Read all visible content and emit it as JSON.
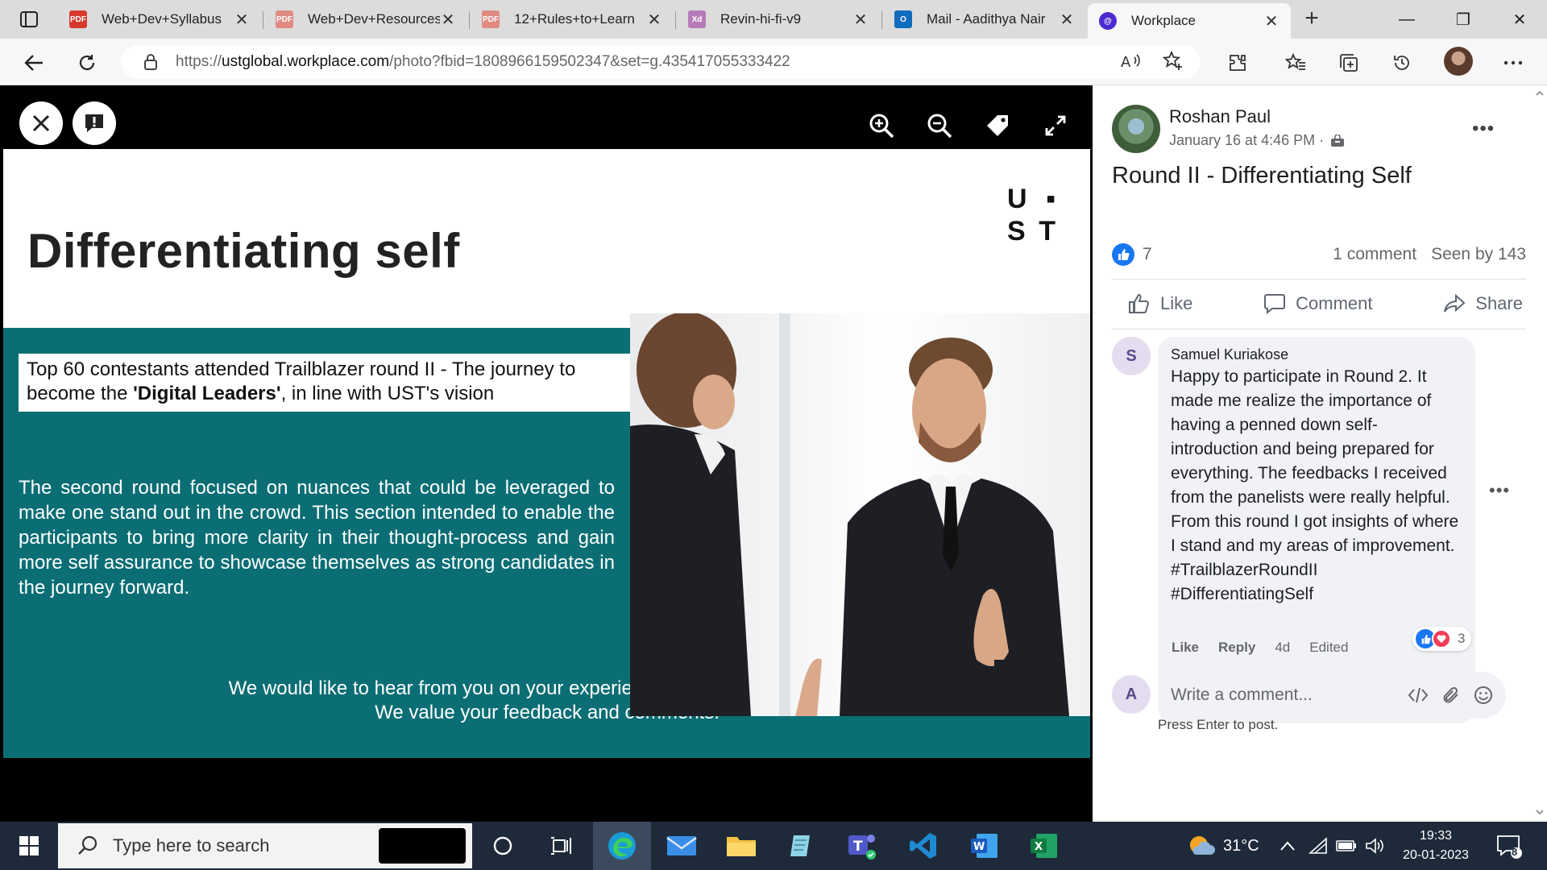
{
  "browser": {
    "tabs": [
      {
        "title": "Web+Dev+Syllabus",
        "favicon": "pdf-icon"
      },
      {
        "title": "Web+Dev+Resources",
        "favicon": "pdf-icon"
      },
      {
        "title": "12+Rules+to+Learn",
        "favicon": "pdf-icon"
      },
      {
        "title": "Revin-hi-fi-v9",
        "favicon": "xd-icon"
      },
      {
        "title": "Mail - Aadithya Nair",
        "favicon": "outlook-icon"
      },
      {
        "title": "Workplace",
        "favicon": "workplace-icon"
      }
    ],
    "favicon_xd": "Xd",
    "url_prefix": "https://",
    "url_host": "ustglobal.workplace.com",
    "url_rest": "/photo?fbid=1808966159502347&set=g.435417055333422"
  },
  "slide": {
    "logo_row1": [
      "U",
      "▪"
    ],
    "logo_row2": [
      "S",
      "T"
    ],
    "title": "Differentiating self",
    "intro_before": "Top 60 contestants attended Trailblazer round II - The journey to become the ",
    "intro_bold": "'Digital Leaders'",
    "intro_after": ", in line with UST's vision",
    "body": "The second round focused on nuances that could be leveraged to make one stand out in the crowd. This section intended to enable the participants to bring more clarity in their thought-process and gain more self assurance to showcase themselves as strong candidates in the journey forward.",
    "footer_line1": "We would like to hear from you on your experience of attending this round.",
    "footer_line2": "We value your feedback and comments."
  },
  "post": {
    "author": "Roshan Paul",
    "date": "January 16 at 4:46 PM ·",
    "title": "Round II - Differentiating Self",
    "like_count": "7",
    "comment_count": "1 comment",
    "seen_by": "Seen by 143",
    "actions": {
      "like": "Like",
      "comment": "Comment",
      "share": "Share"
    }
  },
  "comment": {
    "initial": "S",
    "name": "Samuel Kuriakose",
    "text": "Happy to participate in Round 2. It made me realize the importance of having a penned down self-introduction and being prepared for everything. The feedbacks I received from the panelists were really helpful. From this round I got insights of where I stand and my areas of improvement. #TrailblazerRoundII #DifferentiatingSelf",
    "reaction_count": "3",
    "like": "Like",
    "reply": "Reply",
    "age": "4d",
    "edited": "Edited"
  },
  "composer": {
    "initial": "A",
    "placeholder": "Write a comment...",
    "hint": "Press Enter to post."
  },
  "taskbar": {
    "search_placeholder": "Type here to search",
    "temperature": "31°C",
    "time": "19:33",
    "date": "20-01-2023",
    "notification_count": "8"
  },
  "colors": {
    "teal": "#0b6e74",
    "fb_blue": "#1877f2",
    "love_red": "#f33e58",
    "taskbar": "#1e2a3a"
  }
}
